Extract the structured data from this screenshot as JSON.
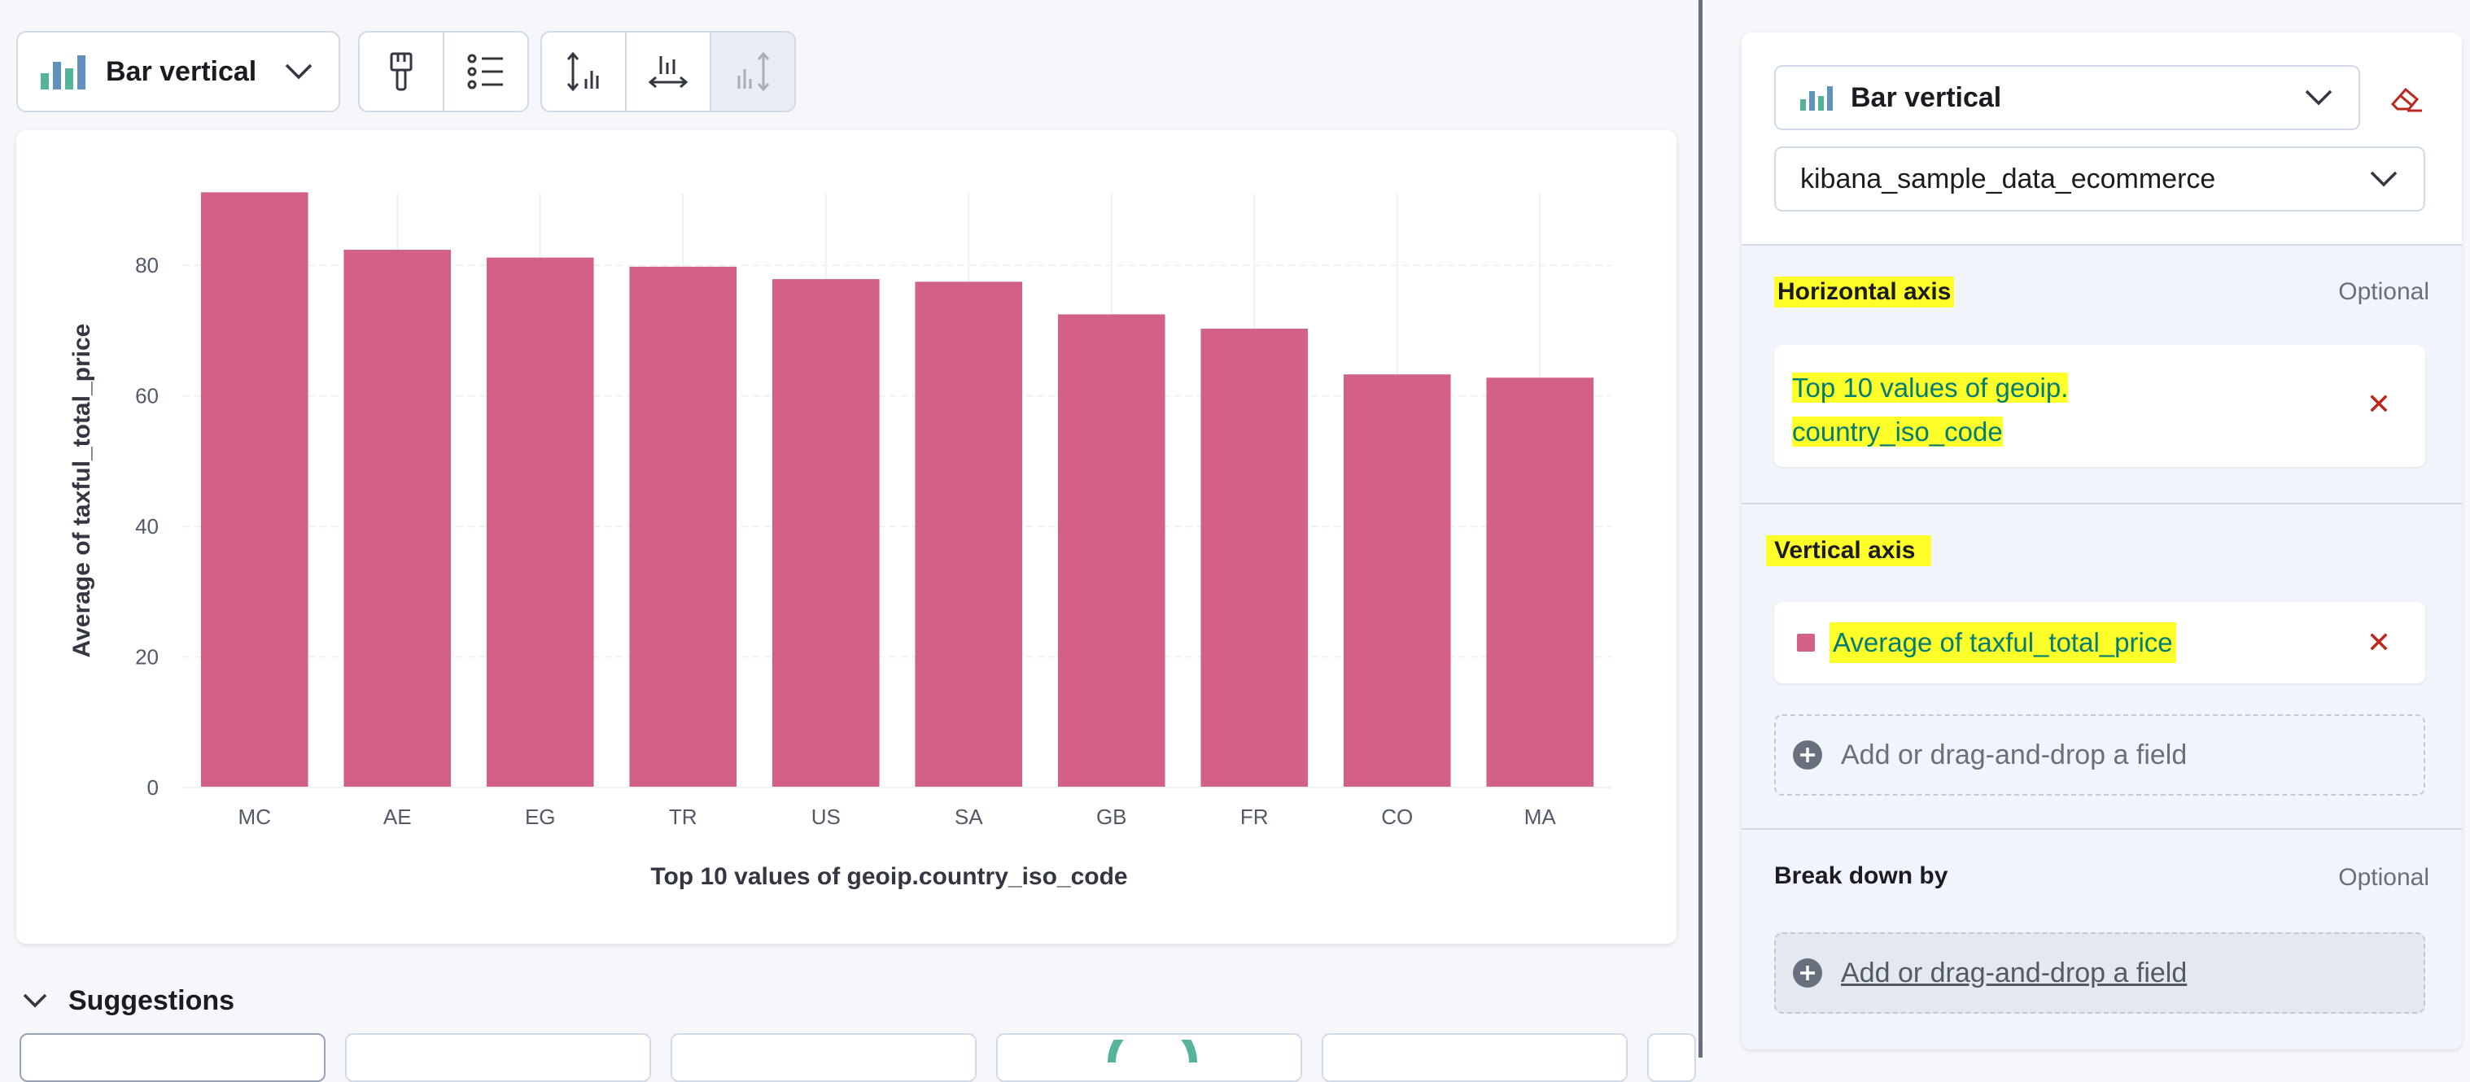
{
  "toolbar": {
    "chart_type_label": "Bar vertical"
  },
  "chart_data": {
    "type": "bar",
    "categories": [
      "MC",
      "AE",
      "EG",
      "TR",
      "US",
      "SA",
      "GB",
      "FR",
      "CO",
      "MA"
    ],
    "values": [
      91.2,
      82.4,
      81.2,
      79.8,
      77.9,
      77.5,
      72.5,
      70.3,
      63.3,
      62.8
    ],
    "ylim": [
      0,
      91
    ],
    "yticks": [
      0,
      20,
      40,
      60,
      80
    ],
    "xlabel": "Top 10 values of geoip.country_iso_code",
    "ylabel": "Average of taxful_total_price",
    "bar_color": "#d36086",
    "grid": true
  },
  "suggestions": {
    "title": "Suggestions"
  },
  "config": {
    "chart_type_label": "Bar vertical",
    "data_view": "kibana_sample_data_ecommerce",
    "horizontal_axis": {
      "label": "Horizontal axis",
      "optional": "Optional",
      "value_line1": "Top 10 values of geoip.",
      "value_line2": "country_iso_code"
    },
    "vertical_axis": {
      "label": "Vertical axis",
      "value": "Average of taxful_total_price",
      "swatch_color": "#d36086",
      "add_field": "Add or drag-and-drop a field"
    },
    "break_down": {
      "label": "Break down by",
      "optional": "Optional",
      "add_field": "Add or drag-and-drop a field"
    }
  }
}
